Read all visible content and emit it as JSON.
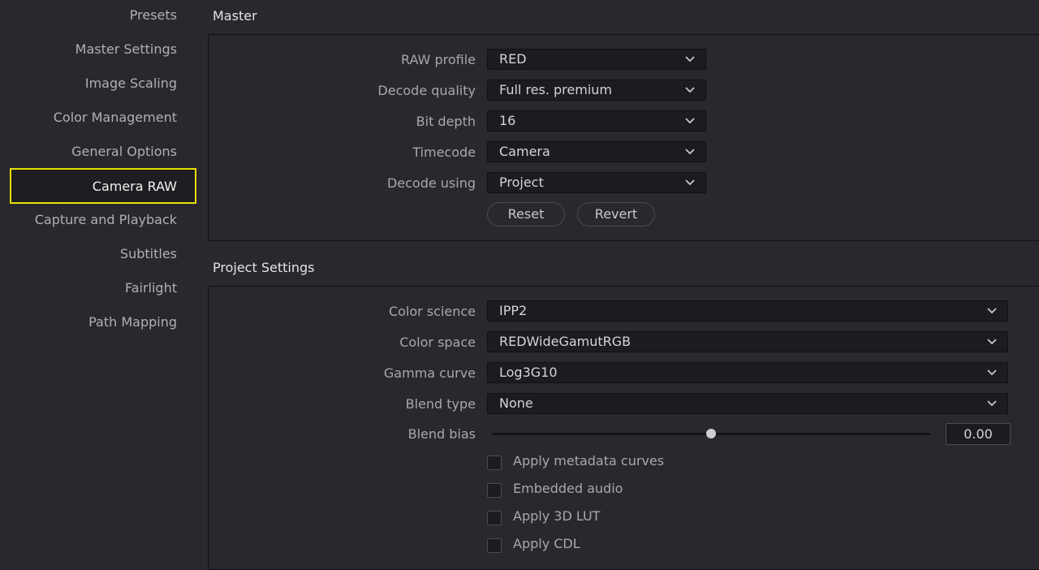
{
  "sidebar": {
    "items": [
      {
        "label": "Presets"
      },
      {
        "label": "Master Settings"
      },
      {
        "label": "Image Scaling"
      },
      {
        "label": "Color Management"
      },
      {
        "label": "General Options"
      },
      {
        "label": "Camera RAW"
      },
      {
        "label": "Capture and Playback"
      },
      {
        "label": "Subtitles"
      },
      {
        "label": "Fairlight"
      },
      {
        "label": "Path Mapping"
      }
    ],
    "active": "Camera RAW",
    "highlight_color": "#e8e000"
  },
  "master": {
    "title": "Master",
    "raw_profile": {
      "label": "RAW profile",
      "value": "RED"
    },
    "decode_quality": {
      "label": "Decode quality",
      "value": "Full res. premium"
    },
    "bit_depth": {
      "label": "Bit depth",
      "value": "16"
    },
    "timecode": {
      "label": "Timecode",
      "value": "Camera"
    },
    "decode_using": {
      "label": "Decode using",
      "value": "Project"
    },
    "reset_label": "Reset",
    "revert_label": "Revert"
  },
  "project": {
    "title": "Project Settings",
    "color_science": {
      "label": "Color science",
      "value": "IPP2"
    },
    "color_space": {
      "label": "Color space",
      "value": "REDWideGamutRGB"
    },
    "gamma_curve": {
      "label": "Gamma curve",
      "value": "Log3G10"
    },
    "blend_type": {
      "label": "Blend type",
      "value": "None"
    },
    "blend_bias": {
      "label": "Blend bias",
      "value": "0.00",
      "slider_fraction": 0.5
    },
    "checkboxes": [
      {
        "label": "Apply metadata curves",
        "checked": false
      },
      {
        "label": "Embedded audio",
        "checked": false
      },
      {
        "label": "Apply 3D LUT",
        "checked": false
      },
      {
        "label": "Apply CDL",
        "checked": false
      }
    ]
  },
  "icons": {
    "dropdown": "chevron-down-icon"
  }
}
